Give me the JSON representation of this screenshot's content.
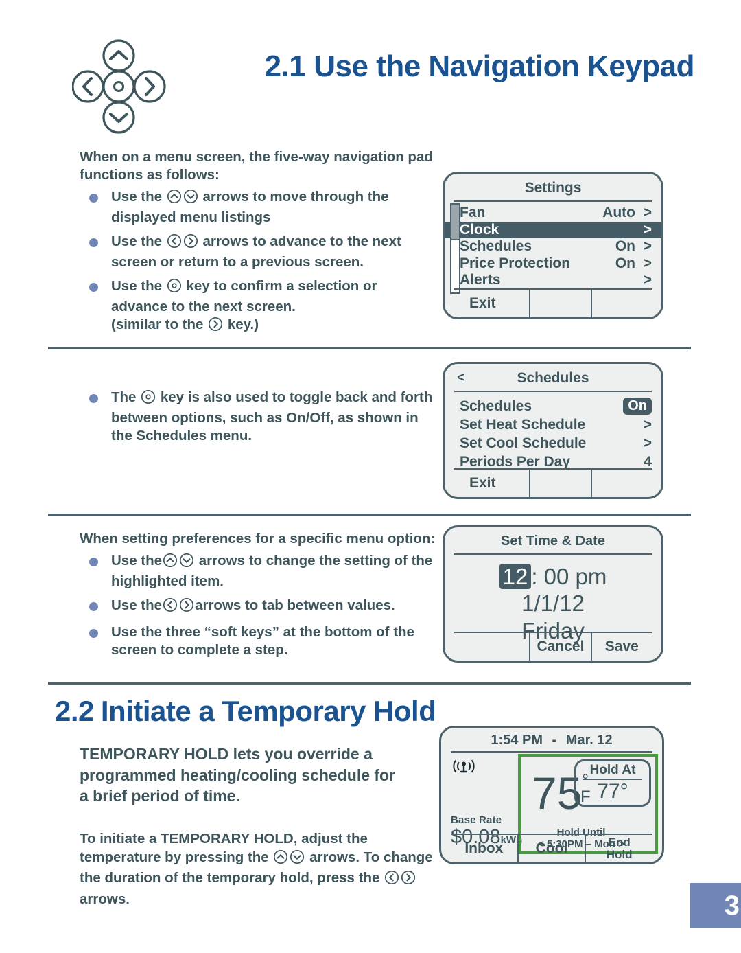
{
  "sections": {
    "s21": {
      "number": "2.1",
      "title": "Use the Navigation Keypad"
    },
    "s22": {
      "number": "2.2",
      "title": "Initiate a Temporary Hold"
    }
  },
  "keypad": {
    "up_icon": "chevron-up-circle-icon",
    "down_icon": "chevron-down-circle-icon",
    "left_icon": "chevron-left-circle-icon",
    "right_icon": "chevron-right-circle-icon",
    "center_icon": "select-center-circle-icon"
  },
  "body": {
    "block1": {
      "lead": "When on a menu screen, the five-way navigation pad functions as follows:",
      "items": [
        {
          "pre": "Use the",
          "icons": [
            "up",
            "down"
          ],
          "post": "arrows to move through the displayed menu listings"
        },
        {
          "pre": "Use the",
          "icons": [
            "left",
            "right"
          ],
          "post": "arrows to advance to the next screen or return to a previous screen."
        },
        {
          "pre": "Use the",
          "icons": [
            "center"
          ],
          "post": "key to confirm a selection or advance to the next screen.",
          "tail_pre": "(similar to the",
          "tail_icons": [
            "right"
          ],
          "tail_post": "key.)"
        }
      ]
    },
    "block2": {
      "items": [
        {
          "pre": "The",
          "icons": [
            "center"
          ],
          "post": "key is also used to toggle back and forth between options, such as On/Off, as shown in the Schedules menu."
        }
      ]
    },
    "block3": {
      "lead": "When setting preferences for a specific menu option:",
      "items": [
        {
          "pre": "Use the",
          "icons": [
            "up",
            "down"
          ],
          "post": "arrows to change the setting of the highlighted item."
        },
        {
          "pre": "Use the",
          "icons": [
            "left",
            "right"
          ],
          "post": "arrows to tab between values."
        },
        {
          "pre": "Use the three “soft keys” at the bottom of the screen to complete a step.",
          "icons": [],
          "post": ""
        }
      ]
    },
    "block4": "TEMPORARY HOLD lets you override a programmed heating/cooling schedule for a brief period of time.",
    "block5": {
      "p1": "To initiate a TEMPORARY HOLD, adjust the temperature by pressing the",
      "icons1": [
        "up",
        "down"
      ],
      "p2": "arrows. To change the duration of the temporary hold, press the",
      "icons2": [
        "left",
        "right"
      ],
      "p3": "arrows."
    }
  },
  "screens": {
    "settings": {
      "title": "Settings",
      "rows": [
        {
          "label": "Fan",
          "value": "Auto",
          "chevron": ">",
          "selected": false
        },
        {
          "label": "Clock",
          "value": "",
          "chevron": ">",
          "selected": true
        },
        {
          "label": "Schedules",
          "value": "On",
          "chevron": ">",
          "selected": false
        },
        {
          "label": "Price Protection",
          "value": "On",
          "chevron": ">",
          "selected": false
        },
        {
          "label": "Alerts",
          "value": "",
          "chevron": ">",
          "selected": false
        }
      ],
      "softkeys": [
        "Exit",
        "",
        ""
      ]
    },
    "schedules": {
      "back": "<",
      "title": "Schedules",
      "rows": [
        {
          "label": "Schedules",
          "value": "On",
          "chevron": "",
          "pill": true
        },
        {
          "label": "Set Heat Schedule",
          "value": "",
          "chevron": ">",
          "pill": false
        },
        {
          "label": "Set Cool Schedule",
          "value": "",
          "chevron": ">",
          "pill": false
        },
        {
          "label": "Periods Per Day",
          "value": "4",
          "chevron": "",
          "pill": false
        }
      ],
      "softkeys": [
        "Exit",
        "",
        ""
      ]
    },
    "time_date": {
      "title": "Set Time & Date",
      "hour": "12",
      "time_rest": ": 00 pm",
      "date": "1/1/12",
      "weekday": "Friday",
      "softkeys": [
        "",
        "Cancel",
        "Save"
      ]
    },
    "home": {
      "clock": "1:54 PM",
      "dash": "-",
      "date": "Mar. 12",
      "signal_icon": "antenna-signal-icon",
      "base_rate_label": "Base Rate",
      "base_rate_value": "$0.08",
      "base_rate_unit": "kWh",
      "temperature": "75",
      "temp_degree": "°",
      "temp_unit": "F",
      "hold_at_label": "Hold At",
      "hold_at_value": "77°",
      "hold_until_label": "Hold Until",
      "hold_until_left": "<",
      "hold_until_value": "5:30PM – Mon",
      "hold_until_right": ">",
      "softkeys": [
        "Inbox",
        "Cool",
        "End Hold"
      ],
      "softkey_end_line1": "End",
      "softkey_end_line2": "Hold"
    }
  },
  "page_number": "3",
  "colors": {
    "heading_blue": "#1b5391",
    "body_slate": "#3e555c",
    "bullet_periwinkle": "#7286b5",
    "device_border": "#4d626b",
    "device_bg": "#eef0f0",
    "highlight_green": "#4a9a42",
    "selection_dark": "#455c66"
  }
}
